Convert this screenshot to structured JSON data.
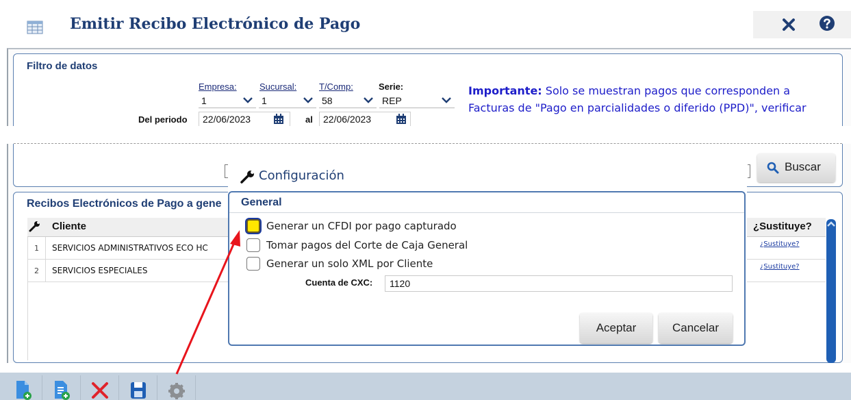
{
  "window": {
    "title": "Emitir Recibo Electrónico de Pago",
    "icons": [
      "table-icon",
      "close-icon",
      "help-icon"
    ]
  },
  "filter": {
    "section_title": "Filtro de datos",
    "empresa_label": "Empresa:",
    "sucursal_label": "Sucursal:",
    "tcomp_label": "T/Comp:",
    "serie_label": "Serie:",
    "empresa_value": "1",
    "sucursal_value": "1",
    "tcomp_value": "58",
    "serie_value": "REP",
    "periodo_label": "Del periodo",
    "fecha_desde": "22/06/2023",
    "al_label": "al",
    "fecha_hasta": "22/06/2023",
    "importante_label": "Importante:",
    "importante_text": " Solo se muestran pagos que corresponden a Facturas de \"Pago en parcialidades o diferido (PPD)\", verificar",
    "buscar_label": "Buscar"
  },
  "grid": {
    "section_title": "Recibos Electrónicos de Pago a gene",
    "col_cliente": "Cliente",
    "col_sustituye": "¿Sustituye?",
    "rows": [
      {
        "num": "1",
        "cliente": "SERVICIOS ADMINISTRATIVOS ECO HC",
        "sustituye": "¿Sustituye?"
      },
      {
        "num": "2",
        "cliente": "SERVICIOS ESPECIALES",
        "sustituye": "¿Sustituye?"
      }
    ]
  },
  "dialog": {
    "title": "Configuración",
    "section": "General",
    "options": [
      {
        "label": "Generar un CFDI por pago capturado",
        "checked": true
      },
      {
        "label": "Tomar pagos del Corte de Caja General",
        "checked": false
      },
      {
        "label": "Generar un solo XML por Cliente",
        "checked": false
      }
    ],
    "cxc_label": "Cuenta de CXC:",
    "cxc_value": "1120",
    "aceptar": "Aceptar",
    "cancelar": "Cancelar"
  },
  "toolbar": {
    "buttons": [
      "new-document-icon",
      "new-list-icon",
      "delete-icon",
      "save-icon",
      "settings-icon"
    ]
  },
  "colors": {
    "title": "#1f3e74",
    "important": "#1d1dc9",
    "highlight": "#ffe600",
    "arrow": "#e8141c",
    "scrollbar": "#1f5fb4",
    "toolbar_bg": "#c5d2df"
  }
}
